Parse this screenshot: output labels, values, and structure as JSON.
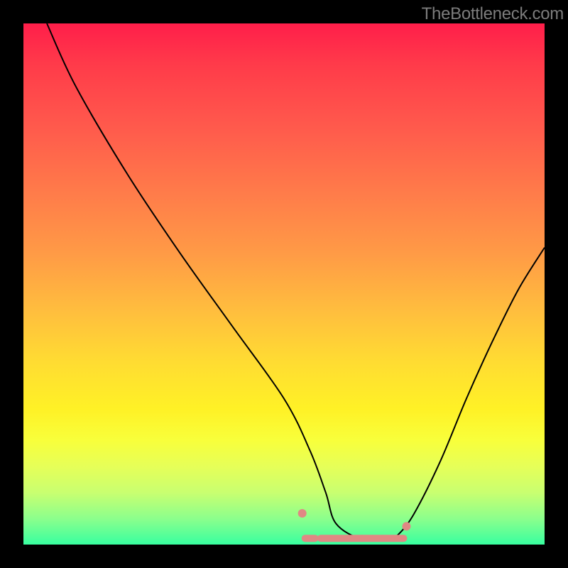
{
  "watermark": "TheBottleneck.com",
  "chart_data": {
    "type": "line",
    "title": "",
    "xlabel": "",
    "ylabel": "",
    "xlim": [
      0,
      100
    ],
    "ylim": [
      0,
      100
    ],
    "series": [
      {
        "name": "curve",
        "x": [
          4.5,
          10,
          20,
          30,
          40,
          50,
          55,
          58,
          60,
          65,
          70,
          72,
          75,
          80,
          85,
          90,
          95,
          100
        ],
        "values": [
          100,
          88,
          71,
          56,
          42,
          28,
          18,
          10,
          4,
          1,
          1,
          2,
          6,
          16,
          28,
          39,
          49,
          57
        ]
      }
    ],
    "rug_marks_x": [
      55,
      58,
      60,
      62,
      64,
      66,
      68,
      70,
      72
    ]
  },
  "colors": {
    "curve": "#000000",
    "rug": "#e08884",
    "background_top": "#ff1e4a",
    "background_bottom": "#38ffa0",
    "frame": "#000000"
  }
}
